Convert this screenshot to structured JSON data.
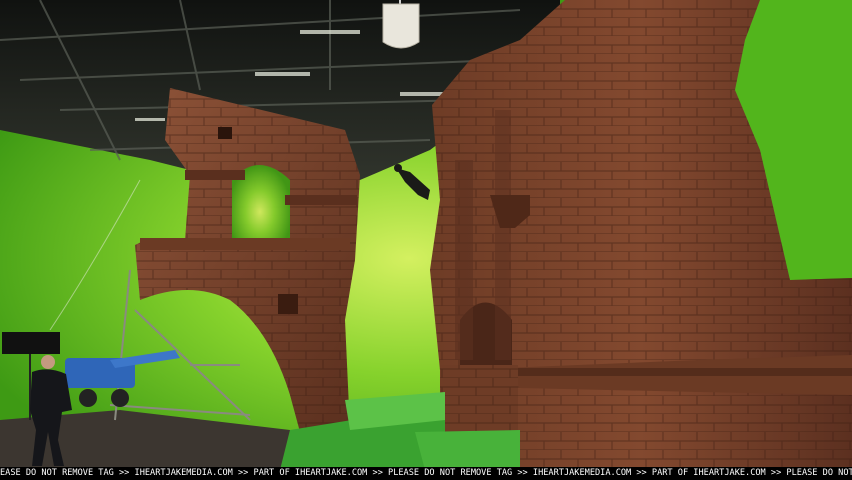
{
  "watermark": {
    "text": "EASE DO NOT REMOVE TAG >> IHEARTJAKEMEDIA.COM >> PART OF IHEARTJAKE.COM >> PLEASE DO NOT REMOVE TAG >> IHEARTJAKEMEDIA.COM >> PART OF IHEARTJAKE.COM >> PLEASE DO NOT REMOVE TAG >> IHEARTJAKEMEDIA.COM >> PART OF IHEARTJAKE.COM >> PLEASE DO NOT REMOVE TAG >> IHEARTJAKE"
  },
  "colors": {
    "greenscreen": "#5fbf1e",
    "greenscreen_glow": "#c9ec5a",
    "brick": "#7a4630",
    "brick_dark": "#4a2618",
    "ceiling": "#1c1e1c",
    "floor_green": "#3ea334"
  }
}
